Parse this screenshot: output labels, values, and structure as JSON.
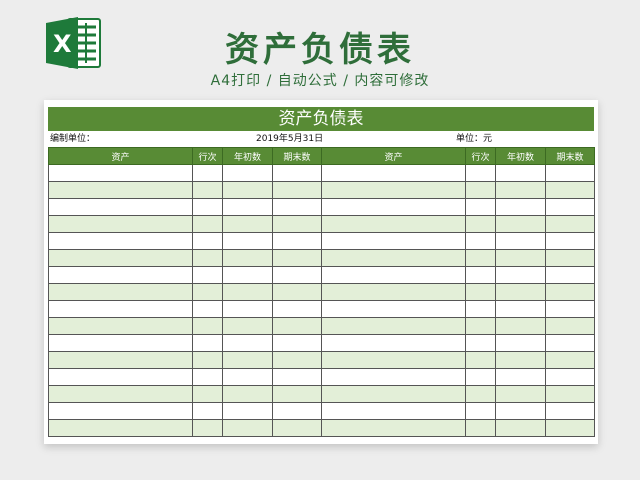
{
  "header": {
    "title": "资产负债表",
    "subtitle": "A4打印 / 自动公式 / 内容可修改",
    "logo_icon": "excel-icon"
  },
  "sheet": {
    "title": "资产负债表",
    "compiler_label": "编制单位：",
    "date": "2019年5月31日",
    "unit_label": "单位：元",
    "columns": [
      "资产",
      "行次",
      "年初数",
      "期末数",
      "资产",
      "行次",
      "年初数",
      "期末数"
    ],
    "row_count": 16
  },
  "colors": {
    "brand_green": "#588b35",
    "title_green": "#2f6e3a",
    "row_alt": "#e3efd8"
  }
}
